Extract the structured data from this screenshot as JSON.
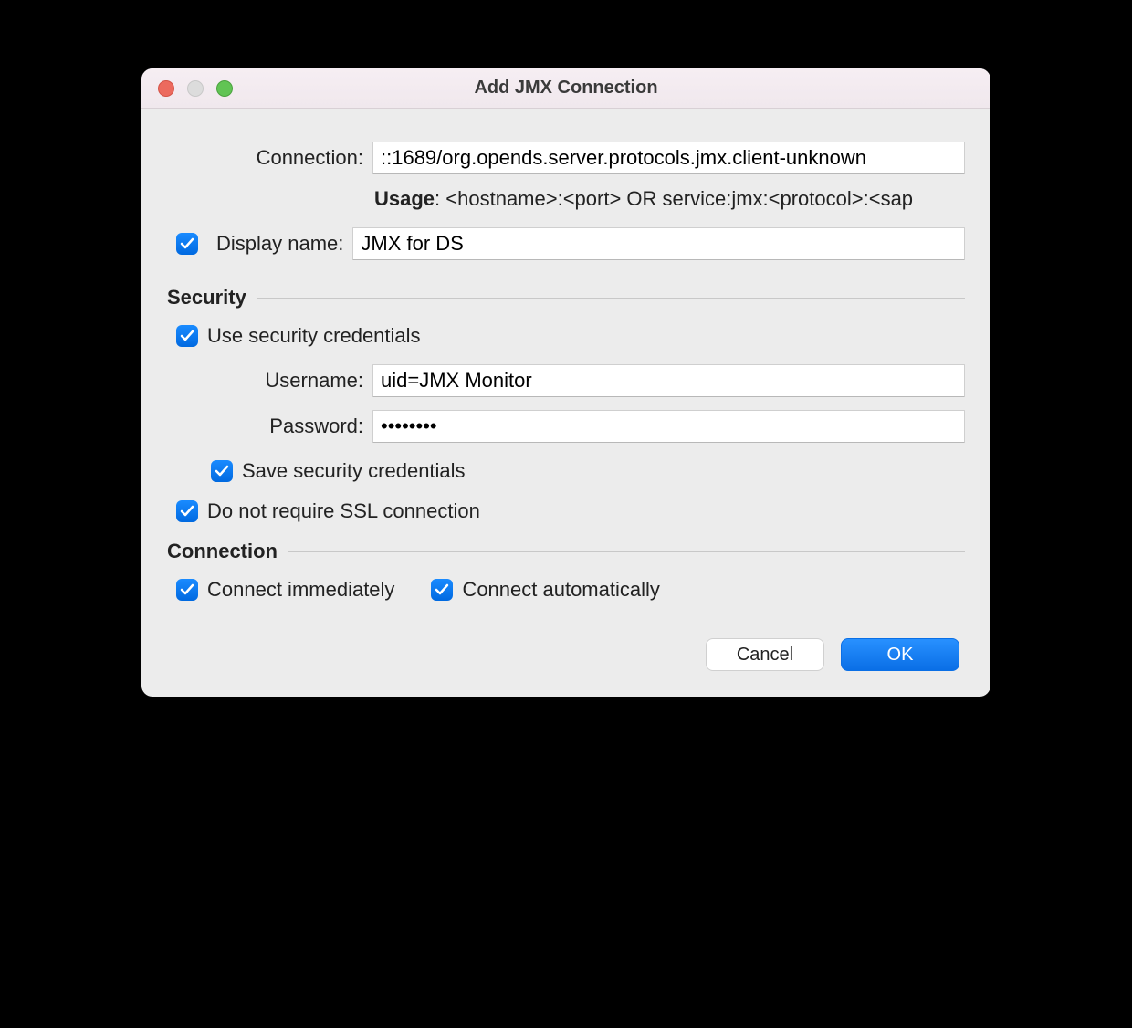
{
  "window": {
    "title": "Add JMX Connection"
  },
  "form": {
    "connection_label": "Connection:",
    "connection_value": "::1689/org.opends.server.protocols.jmx.client-unknown",
    "usage_prefix": "Usage",
    "usage_text": ": <hostname>:<port> OR service:jmx:<protocol>:<sap",
    "displayname_checkbox_label": "Display name:",
    "displayname_value": "JMX for DS"
  },
  "security": {
    "heading": "Security",
    "use_credentials_label": "Use security credentials",
    "username_label": "Username:",
    "username_value": "uid=JMX Monitor",
    "password_label": "Password:",
    "password_value": "password",
    "save_credentials_label": "Save security credentials",
    "no_ssl_label": "Do not require SSL connection"
  },
  "connection_section": {
    "heading": "Connection",
    "connect_immediately_label": "Connect immediately",
    "connect_automatically_label": "Connect automatically"
  },
  "buttons": {
    "cancel": "Cancel",
    "ok": "OK"
  }
}
